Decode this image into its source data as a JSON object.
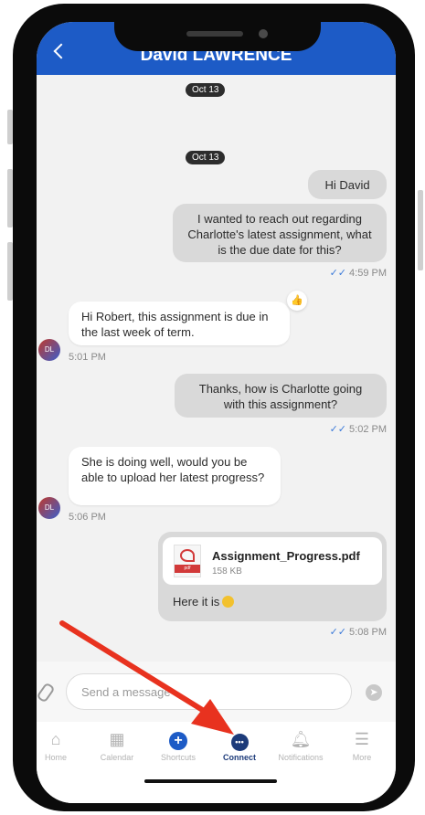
{
  "header": {
    "title": "David LAWRENCE"
  },
  "date_chips": [
    "Oct 13",
    "Oct 13"
  ],
  "messages": [
    {
      "text": "Hi David"
    },
    {
      "text": "I wanted to reach out regarding Charlotte's latest assignment, what is the due date for this?",
      "time": "4:59 PM"
    },
    {
      "text": "Hi Robert, this assignment is due in the last week of term.",
      "time": "5:01 PM",
      "avatar": "DL"
    },
    {
      "text": "Thanks, how is Charlotte going with this assignment?",
      "time": "5:02 PM"
    },
    {
      "text": "She is doing well, would you be able to upload her latest progress?",
      "time": "5:06 PM",
      "avatar": "DL"
    }
  ],
  "attachment": {
    "file_name": "Assignment_Progress.pdf",
    "file_size": "158 KB",
    "pdf_label": "pdf",
    "caption": "Here it is",
    "time": "5:08 PM"
  },
  "composer": {
    "placeholder": "Send a message"
  },
  "tabs": [
    {
      "label": "Home",
      "icon": "home-icon"
    },
    {
      "label": "Calendar",
      "icon": "calendar-icon"
    },
    {
      "label": "Shortcuts",
      "icon": "plus-circle-icon"
    },
    {
      "label": "Connect",
      "icon": "chat-bubble-icon",
      "active": true
    },
    {
      "label": "Notifications",
      "icon": "bell-icon"
    },
    {
      "label": "More",
      "icon": "menu-icon"
    }
  ],
  "colors": {
    "header": "#1d5bc6",
    "active_tab": "#1d3b7a",
    "annotation_arrow": "#e8321f"
  }
}
